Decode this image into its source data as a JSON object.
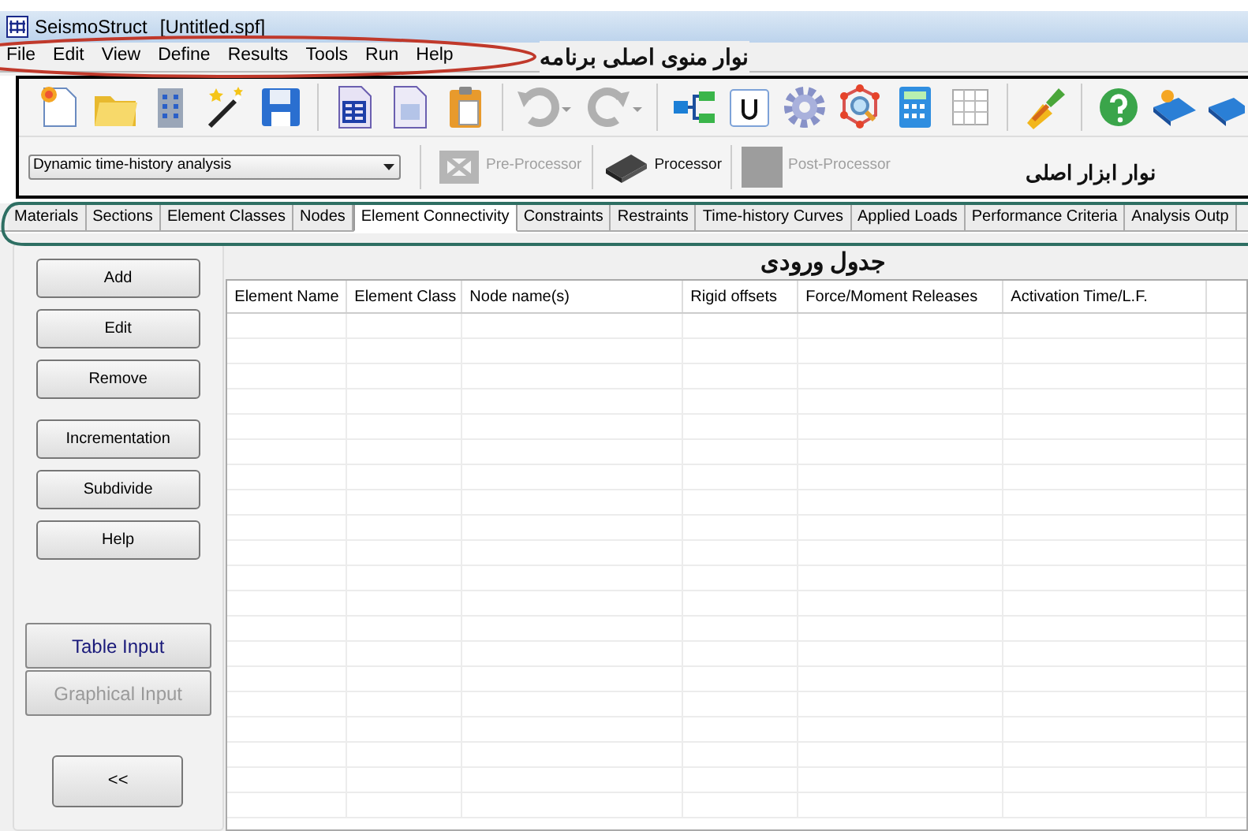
{
  "window": {
    "title": "SeismoStruct",
    "file": "[Untitled.spf]"
  },
  "menu": [
    "File",
    "Edit",
    "View",
    "Define",
    "Results",
    "Tools",
    "Run",
    "Help"
  ],
  "analysis_type": {
    "value": "Dynamic time-history analysis"
  },
  "modes": [
    {
      "label": "Pre-Processor",
      "disabled": true
    },
    {
      "label": "Processor",
      "disabled": false
    },
    {
      "label": "Post-Processor",
      "disabled": true
    }
  ],
  "tabs": [
    {
      "label": "Materials",
      "selected": false
    },
    {
      "label": "Sections",
      "selected": false
    },
    {
      "label": "Element Classes",
      "selected": false
    },
    {
      "label": "Nodes",
      "selected": false
    },
    {
      "label": "Element Connectivity",
      "selected": true
    },
    {
      "label": "Constraints",
      "selected": false
    },
    {
      "label": "Restraints",
      "selected": false
    },
    {
      "label": "Time-history Curves",
      "selected": false
    },
    {
      "label": "Applied Loads",
      "selected": false
    },
    {
      "label": "Performance Criteria",
      "selected": false
    },
    {
      "label": "Analysis Outp",
      "selected": false
    }
  ],
  "side_buttons": [
    "Add",
    "Edit",
    "Remove",
    "Incrementation",
    "Subdivide",
    "Help"
  ],
  "input_modes": [
    {
      "label": "Table Input",
      "disabled": false
    },
    {
      "label": "Graphical Input",
      "disabled": true
    }
  ],
  "collapse_button": "<<",
  "table": {
    "columns": [
      "Element Name",
      "Element Class",
      "Node name(s)",
      "Rigid offsets",
      "Force/Moment Releases",
      "Activation Time/L.F."
    ]
  },
  "annotations": {
    "menu": "نوار منوی اصلی برنامه",
    "toolbar": "نوار ابزار اصلی",
    "table": "جدول ورودی"
  }
}
